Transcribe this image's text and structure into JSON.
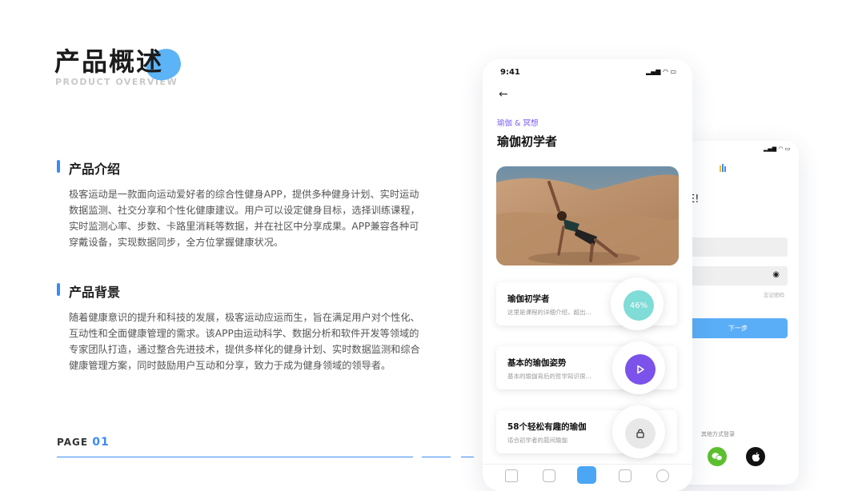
{
  "header": {
    "title": "产品概述",
    "subtitle": "PRODUCT OVERVIEW"
  },
  "sections": [
    {
      "title": "产品介绍",
      "lines": [
        "极客运动是一款面向运动爱好者的综合性健身APP，提供多种健身计划、实时运动",
        "数据监测、社交分享和个性化健康建议。用户可以设定健身目标，选择训练课程，",
        "实时监测心率、步数、卡路里消耗等数据，并在社区中分享成果。APP兼容各种可",
        "穿戴设备，实现数据同步，全方位掌握健康状况。"
      ]
    },
    {
      "title": "产品背景",
      "lines": [
        "随着健康意识的提升和科技的发展，极客运动应运而生，旨在满足用户对个性化、",
        "互动性和全面健康管理的需求。该APP由运动科学、数据分析和软件开发等领域的",
        "专家团队打造，通过整合先进技术，提供多样化的健身计划、实时数据监测和综合",
        "健康管理方案，同时鼓励用户互动和分享，致力于成为健身领域的领导者。"
      ]
    }
  ],
  "footer": {
    "page_label": "PAGE",
    "page_number": "01"
  },
  "phone_main": {
    "time": "9:41",
    "category": "瑜伽 & 冥想",
    "title": "瑜伽初学者",
    "cards": [
      {
        "title": "瑜伽初学者",
        "subtitle": "这里是课程的详细介绍，超出...",
        "badge": "46%",
        "progress": 0.46
      },
      {
        "title": "基本的瑜伽姿势",
        "subtitle": "基本的瑜伽背后的哲学知识很..."
      },
      {
        "title": "58个轻松有趣的瑜伽",
        "subtitle": "适合初学者的晨间瑜伽"
      }
    ]
  },
  "phone_back": {
    "title_fragment": "E!",
    "forgot": "忘记密码",
    "button": "下一步",
    "other_login": "其他方式登录",
    "social": [
      "wechat-icon",
      "apple-icon"
    ]
  },
  "colors": {
    "accent": "#3d8bf2",
    "purple": "#7b52ea",
    "teal": "#7fdcd6",
    "button": "#5aaef7",
    "wechat": "#5bbf2e"
  }
}
